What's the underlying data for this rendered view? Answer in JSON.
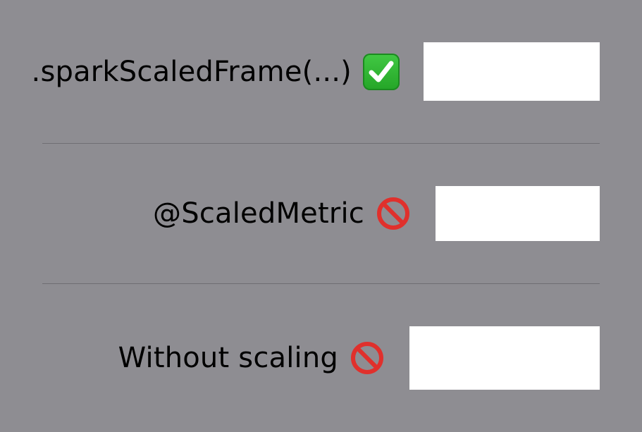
{
  "rows": [
    {
      "label": ".sparkScaledFrame(...)",
      "status": "check-icon"
    },
    {
      "label": "@ScaledMetric",
      "status": "prohibited-icon"
    },
    {
      "label": "Without scaling",
      "status": "prohibited-icon"
    }
  ],
  "colors": {
    "background": "#8e8d92",
    "box": "#ffffff",
    "divider": "#6f6e73",
    "check_green": "#2fb833",
    "prohibit_red": "#e0302c"
  }
}
